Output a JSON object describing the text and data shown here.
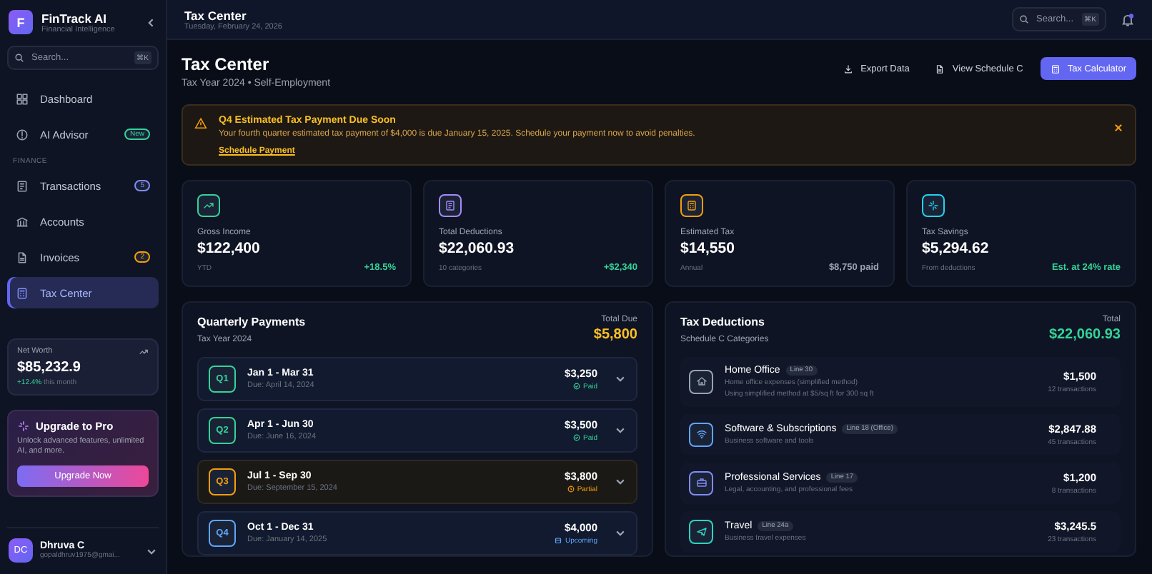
{
  "sidebar": {
    "brand": {
      "initial": "F",
      "name": "FinTrack AI",
      "tagline": "Financial Intelligence"
    },
    "search": {
      "placeholder": "Search...",
      "shortcut": "⌘K"
    },
    "nav": [
      {
        "kind": "item",
        "label": "Dashboard",
        "selected": false
      },
      {
        "kind": "item",
        "label": "AI Advisor",
        "badge": {
          "text": "New",
          "color": "#34d399"
        },
        "selected": false
      },
      {
        "kind": "section",
        "label": "FINANCE"
      },
      {
        "kind": "item",
        "label": "Transactions",
        "badge": {
          "text": "5",
          "color": "#818cf8"
        },
        "selected": false
      },
      {
        "kind": "item",
        "label": "Accounts",
        "selected": false
      },
      {
        "kind": "item",
        "label": "Invoices",
        "badge": {
          "text": "2",
          "color": "#f59e0b"
        },
        "selected": false
      },
      {
        "kind": "item",
        "label": "Tax Center",
        "selected": true
      }
    ],
    "net_worth": {
      "label": "Net Worth",
      "value": "$85,232.9",
      "change": "+12.4%",
      "note": "this month"
    },
    "upgrade": {
      "title": "Upgrade to Pro",
      "text": "Unlock advanced features, unlimited AI, and more.",
      "button": "Upgrade Now"
    },
    "user": {
      "initials": "DC",
      "name": "Dhruva C",
      "email": "gopaldhruv1975@gmai..."
    }
  },
  "topbar": {
    "title": "Tax Center",
    "date": "Tuesday, February 24, 2026",
    "search": {
      "placeholder": "Search...",
      "shortcut": "⌘K"
    }
  },
  "page": {
    "title": "Tax Center",
    "subtitle": "Tax Year 2024 • Self-Employment",
    "actions": [
      {
        "kind": "plain",
        "label": "Export Data"
      },
      {
        "kind": "plain",
        "label": "View Schedule C"
      },
      {
        "kind": "primary",
        "label": "Tax Calculator"
      }
    ]
  },
  "alert": {
    "title": "Q4 Estimated Tax Payment Due Soon",
    "text": "Your fourth quarter estimated tax payment of $4,000 is due January 15, 2025. Schedule your payment now to avoid penalties.",
    "link": "Schedule Payment"
  },
  "stats": [
    {
      "color": "#34d399",
      "label": "Gross Income",
      "value": "$122,400",
      "note": "YTD",
      "change": {
        "text": "+18.5%",
        "color": "#34d399"
      }
    },
    {
      "color": "#a78bfa",
      "label": "Total Deductions",
      "value": "$22,060.93",
      "note": "10 categories",
      "change": {
        "text": "+$2,340",
        "color": "#34d399"
      }
    },
    {
      "color": "#f59e0b",
      "label": "Estimated Tax",
      "value": "$14,550",
      "note": "Annual",
      "change": {
        "text": "$8,750 paid",
        "color": "#9ca3af"
      }
    },
    {
      "color": "#22d3ee",
      "label": "Tax Savings",
      "value": "$5,294.62",
      "note": "From deductions",
      "change": {
        "text": "Est. at 24% rate",
        "color": "#34d399"
      }
    }
  ],
  "quarterly": {
    "title": "Quarterly Payments",
    "subtitle": "Tax Year 2024",
    "total_label": "Total Due",
    "total": "$5,800",
    "payments": [
      {
        "quarter": "Q1",
        "period": "Jan 1 - Mar 31",
        "due": "Due: April 14, 2024",
        "amount": "$3,250",
        "status": "Paid",
        "kind": "paid",
        "color": "#34d399"
      },
      {
        "quarter": "Q2",
        "period": "Apr 1 - Jun 30",
        "due": "Due: June 16, 2024",
        "amount": "$3,500",
        "status": "Paid",
        "kind": "paid",
        "color": "#34d399"
      },
      {
        "quarter": "Q3",
        "period": "Jul 1 - Sep 30",
        "due": "Due: September 15, 2024",
        "amount": "$3,800",
        "status": "Partial",
        "kind": "partial",
        "color": "#f59e0b"
      },
      {
        "quarter": "Q4",
        "period": "Oct 1 - Dec 31",
        "due": "Due: January 14, 2025",
        "amount": "$4,000",
        "status": "Upcoming",
        "kind": "upcoming",
        "color": "#60a5fa"
      }
    ]
  },
  "deductions": {
    "title": "Tax Deductions",
    "subtitle": "Schedule C Categories",
    "total_label": "Total",
    "total": "$22,060.93",
    "items": [
      {
        "color": "#9ca3af",
        "name": "Home Office",
        "line": "Line 30",
        "description": "Home office expenses (simplified method)",
        "note": "Using simplified method at $5/sq ft for 300 sq ft",
        "amount": "$1,500",
        "count": "12 transactions"
      },
      {
        "color": "#60a5fa",
        "name": "Software & Subscriptions",
        "line": "Line 18 (Office)",
        "description": "Business software and tools",
        "amount": "$2,847.88",
        "count": "45 transactions"
      },
      {
        "color": "#818cf8",
        "name": "Professional Services",
        "line": "Line 17",
        "description": "Legal, accounting, and professional fees",
        "amount": "$1,200",
        "count": "8 transactions"
      },
      {
        "color": "#2dd4bf",
        "name": "Travel",
        "line": "Line 24a",
        "description": "Business travel expenses",
        "amount": "$3,245.5",
        "count": "23 transactions"
      }
    ]
  }
}
